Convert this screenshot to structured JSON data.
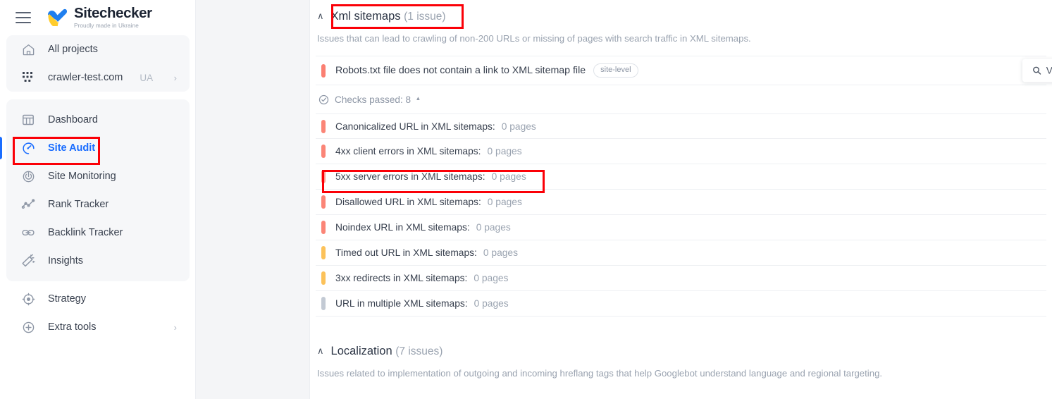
{
  "brand": {
    "name": "Sitechecker",
    "tagline": "Proudly made in Ukraine",
    "menu_icon": "hamburger-menu-icon",
    "logo_icon": "sitechecker-heart-logo"
  },
  "sidebar": {
    "top_group": [
      {
        "label": "All projects",
        "icon": "home-icon",
        "suffix": "",
        "chevron": ""
      },
      {
        "label": "crawler-test.com",
        "icon": "grid-dots-icon",
        "suffix": "UA",
        "chevron": "›"
      }
    ],
    "main_group": [
      {
        "label": "Dashboard",
        "icon": "dashboard-icon",
        "active": false
      },
      {
        "label": "Site Audit",
        "icon": "site-audit-gauge-icon",
        "active": true
      },
      {
        "label": "Site Monitoring",
        "icon": "site-monitoring-icon",
        "active": false
      },
      {
        "label": "Rank Tracker",
        "icon": "rank-tracker-chart-icon",
        "active": false
      },
      {
        "label": "Backlink Tracker",
        "icon": "link-chain-icon",
        "active": false
      },
      {
        "label": "Insights",
        "icon": "magic-wand-icon",
        "active": false
      }
    ],
    "bottom_group": [
      {
        "label": "Strategy",
        "icon": "target-icon",
        "chevron": ""
      },
      {
        "label": "Extra tools",
        "icon": "plus-circle-icon",
        "chevron": "›"
      }
    ]
  },
  "main": {
    "sections": [
      {
        "title": "Xml sitemaps",
        "count": "(1 issue)",
        "caret": "∧",
        "description": "Issues that can lead to crawling of non-200 URLs or missing of pages with search traffic in XML sitemaps."
      },
      {
        "title": "Localization",
        "count": "(7 issues)",
        "caret": "∧",
        "description": "Issues related to implementation of outgoing and incoming hreflang tags that help Googlebot understand language and regional targeting."
      }
    ],
    "issue": {
      "label": "Robots.txt file does not contain a link to XML sitemap file",
      "badge": "site-level",
      "severity_color": "#fb7f72",
      "view_button": "View issue",
      "view_button_icon": "search-icon"
    },
    "checks_passed": {
      "icon": "check-circle-icon",
      "label": "Checks passed: 8",
      "caret": "▴"
    },
    "checks": [
      {
        "name": "Canonicalized URL in XML sitemaps:",
        "value": "0 pages",
        "color": "#fb8577"
      },
      {
        "name": "4xx client errors in XML sitemaps:",
        "value": "0 pages",
        "color": "#fb8577"
      },
      {
        "name": "5xx server errors in XML sitemaps:",
        "value": "0 pages",
        "color": "#fb9b90"
      },
      {
        "name": "Disallowed URL in XML sitemaps:",
        "value": "0 pages",
        "color": "#fb8577"
      },
      {
        "name": "Noindex URL in XML sitemaps:",
        "value": "0 pages",
        "color": "#fb8577"
      },
      {
        "name": "Timed out URL in XML sitemaps:",
        "value": "0 pages",
        "color": "#fcc25a"
      },
      {
        "name": "3xx redirects in XML sitemaps:",
        "value": "0 pages",
        "color": "#fcc25a"
      },
      {
        "name": "URL in multiple XML sitemaps:",
        "value": "0 pages",
        "color": "#c3cad4"
      }
    ]
  },
  "annotations": {
    "color": "#fb0007",
    "boxes": [
      {
        "name": "xml-sitemaps-title"
      },
      {
        "name": "site-audit-nav-item"
      },
      {
        "name": "5xx-server-errors-row"
      }
    ]
  }
}
